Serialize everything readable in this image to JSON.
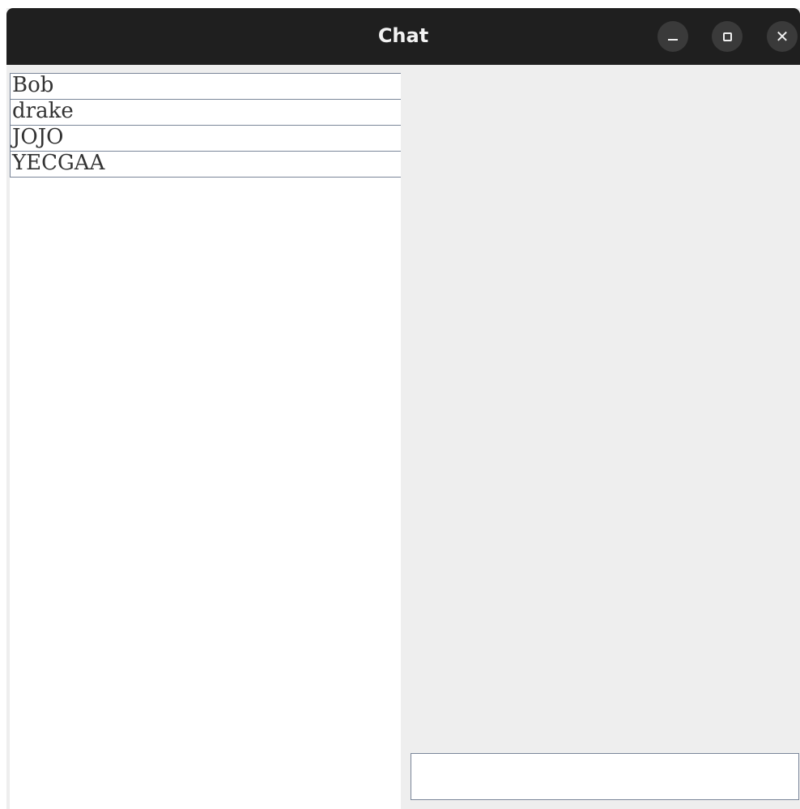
{
  "window": {
    "title": "Chat"
  },
  "titlebar": {
    "minimize_icon": "minimize-icon",
    "maximize_icon": "maximize-icon",
    "close_icon": "close-icon",
    "close_glyph": "✕"
  },
  "users": [
    {
      "name": "Bob"
    },
    {
      "name": "drake"
    },
    {
      "name": "JOJO"
    },
    {
      "name": "YECGAA"
    }
  ],
  "message_input": {
    "value": "",
    "placeholder": ""
  },
  "colors": {
    "titlebar_bg": "#1f1f1f",
    "window_bg": "#eeeeee",
    "list_bg": "#ffffff",
    "border": "#7a8699"
  }
}
